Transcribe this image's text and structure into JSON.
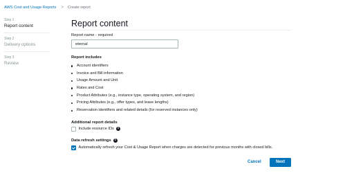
{
  "breadcrumb": {
    "parent": "AWS Cost and Usage Reports",
    "separator": ">",
    "current": "Create report"
  },
  "steps": [
    {
      "number": "Step 1",
      "name": "Report content",
      "active": true
    },
    {
      "number": "Step 2",
      "name": "Delivery options",
      "active": false
    },
    {
      "number": "Step 3",
      "name": "Review",
      "active": false
    }
  ],
  "page_title": "Report content",
  "report_name": {
    "label": "Report name - required",
    "value": "eternal"
  },
  "report_includes": {
    "heading": "Report includes",
    "items": [
      "Account identifiers",
      "Invoice and Bill information",
      "Usage Amount and Unit",
      "Rates and Cost",
      "Product Attributes (e.g., instance type, operating system, and region)",
      "Pricing Attributes (e.g., offer types, and lease lengths)",
      "Reservation identifiers and related details (for reserved instances only)"
    ]
  },
  "additional_details": {
    "heading": "Additional report details",
    "include_resource_ids": {
      "label": "Include resource IDs",
      "checked": false
    }
  },
  "data_refresh": {
    "heading": "Data refresh settings",
    "auto_refresh": {
      "label": "Automatically refresh your Cost & Usage Report when charges are detected for previous months with closed bills.",
      "checked": true
    }
  },
  "info_icon": "info-icon",
  "buttons": {
    "cancel": "Cancel",
    "next": "Next"
  },
  "colors": {
    "accent": "#0073bb",
    "text": "#16191f",
    "muted": "#879596",
    "border": "#eaeded"
  }
}
